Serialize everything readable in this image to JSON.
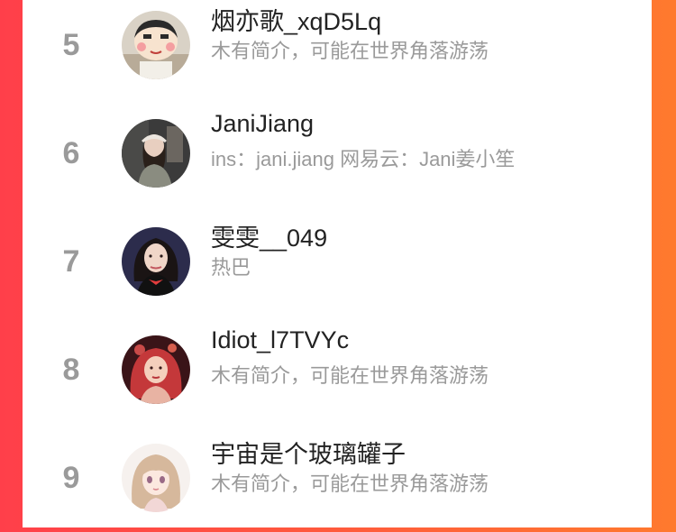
{
  "ranking": {
    "items": [
      {
        "rank": "5",
        "name": "烟亦歌_xqD5Lq",
        "bio": "木有简介，可能在世界角落游荡",
        "avatar": "cartoon-boy-avatar"
      },
      {
        "rank": "6",
        "name": "JaniJiang",
        "bio": "ins：jani.jiang 网易云：Jani姜小笙",
        "avatar": "woman-cap-photo-avatar"
      },
      {
        "rank": "7",
        "name": "雯雯__049",
        "bio": "热巴",
        "avatar": "woman-portrait-avatar"
      },
      {
        "rank": "8",
        "name": "Idiot_l7TVYc",
        "bio": "木有简介，可能在世界角落游荡",
        "avatar": "red-hair-illustration-avatar"
      },
      {
        "rank": "9",
        "name": "宇宙是个玻璃罐子",
        "bio": "木有简介，可能在世界角落游荡",
        "avatar": "anime-girl-avatar"
      }
    ]
  },
  "colors": {
    "background_left": "#ff3f4a",
    "background_right": "#ff7a2e",
    "rank_gray": "#9a9a9a",
    "name_text": "#222222",
    "bio_text": "#9a9a9a"
  }
}
